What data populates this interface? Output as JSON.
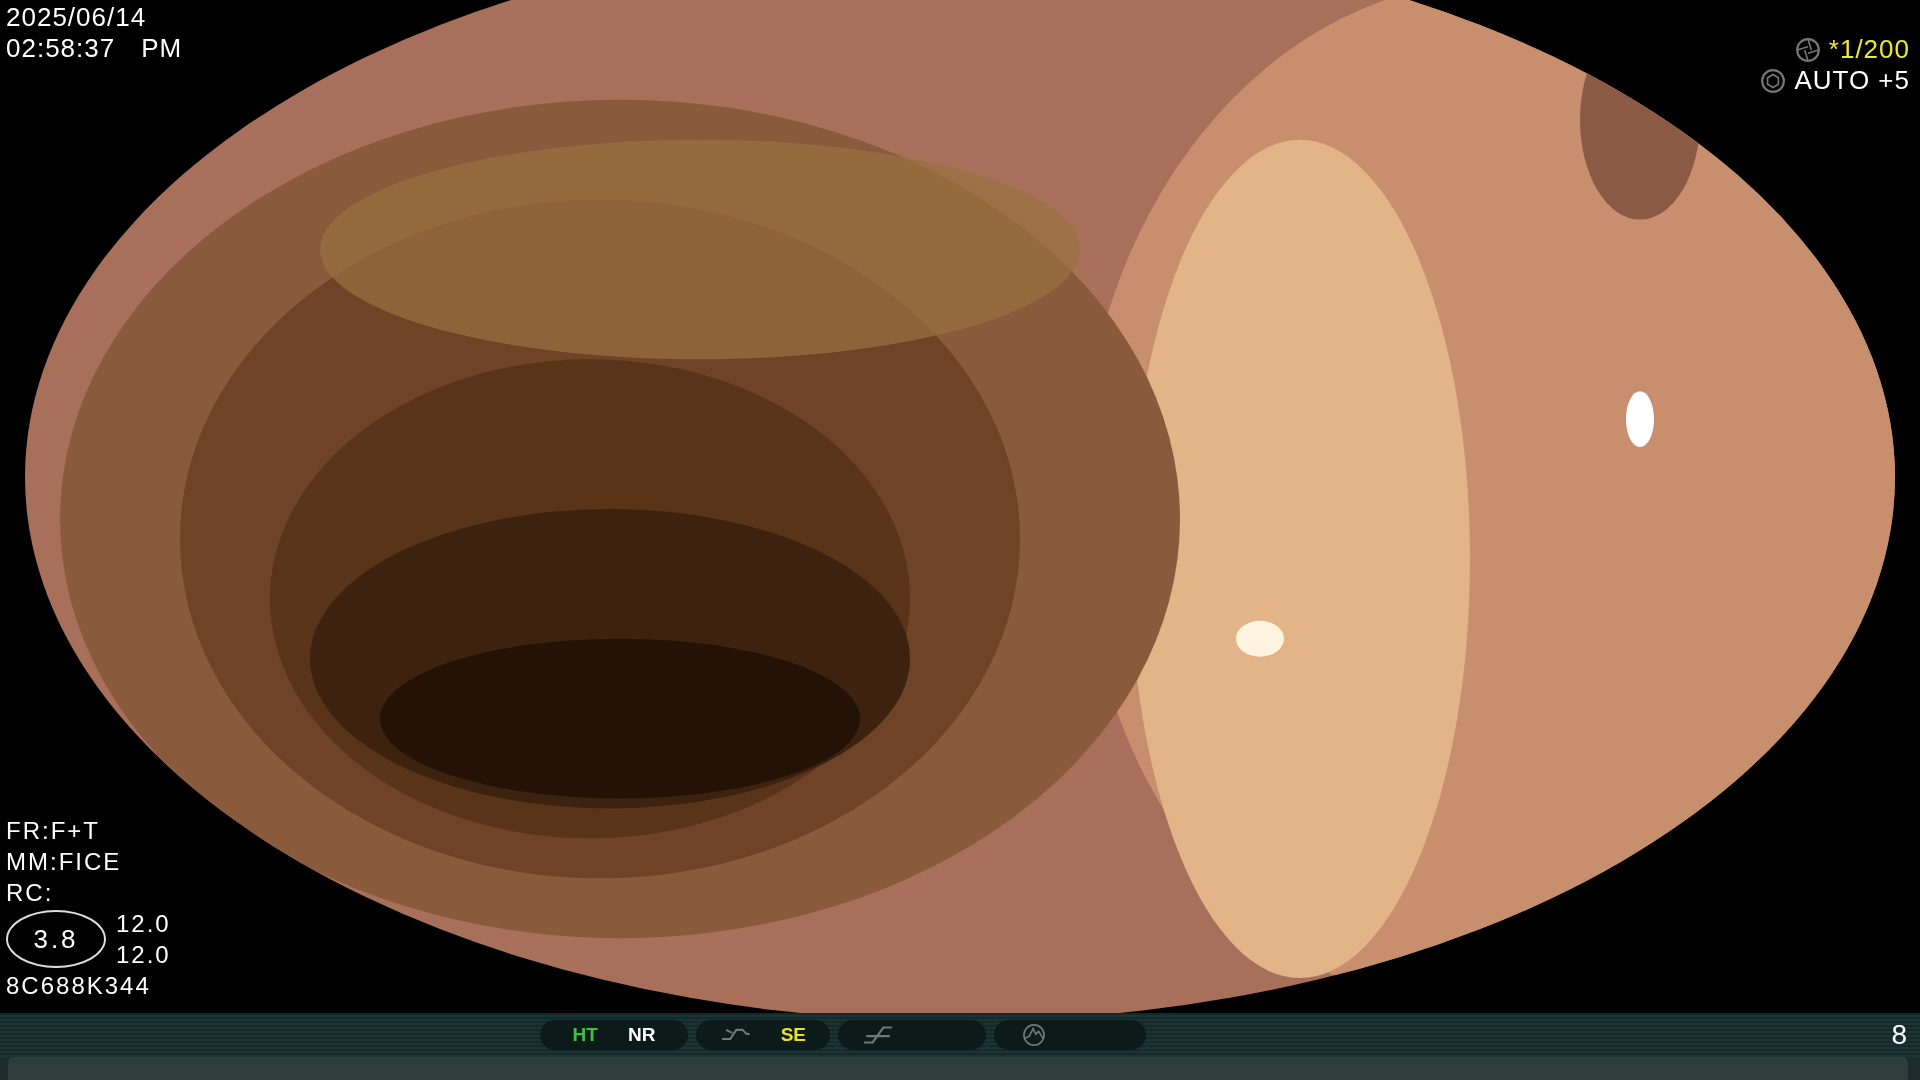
{
  "timestamp": {
    "date": "2025/06/14",
    "time": "02:58:37",
    "meridiem": "PM"
  },
  "exposure": {
    "shutter": "*1/200",
    "iris": "AUTO +5"
  },
  "settings": [
    "FR:F+T",
    "MM:FICE",
    "RC:"
  ],
  "zoom": {
    "value": "3.8",
    "readings": [
      "12.0",
      "12.0"
    ]
  },
  "scope_id": "8C688K344",
  "status_bar": {
    "groups": [
      {
        "kind": "labels",
        "items": [
          {
            "label": "HT",
            "color": "#3ec23e"
          },
          {
            "label": "NR",
            "color": "#ffffff"
          }
        ]
      },
      {
        "kind": "curve",
        "items": [
          {
            "label": "SE",
            "color": "#e8e030"
          }
        ]
      },
      {
        "kind": "ramp"
      },
      {
        "kind": "histogram"
      }
    ],
    "page": "8"
  }
}
